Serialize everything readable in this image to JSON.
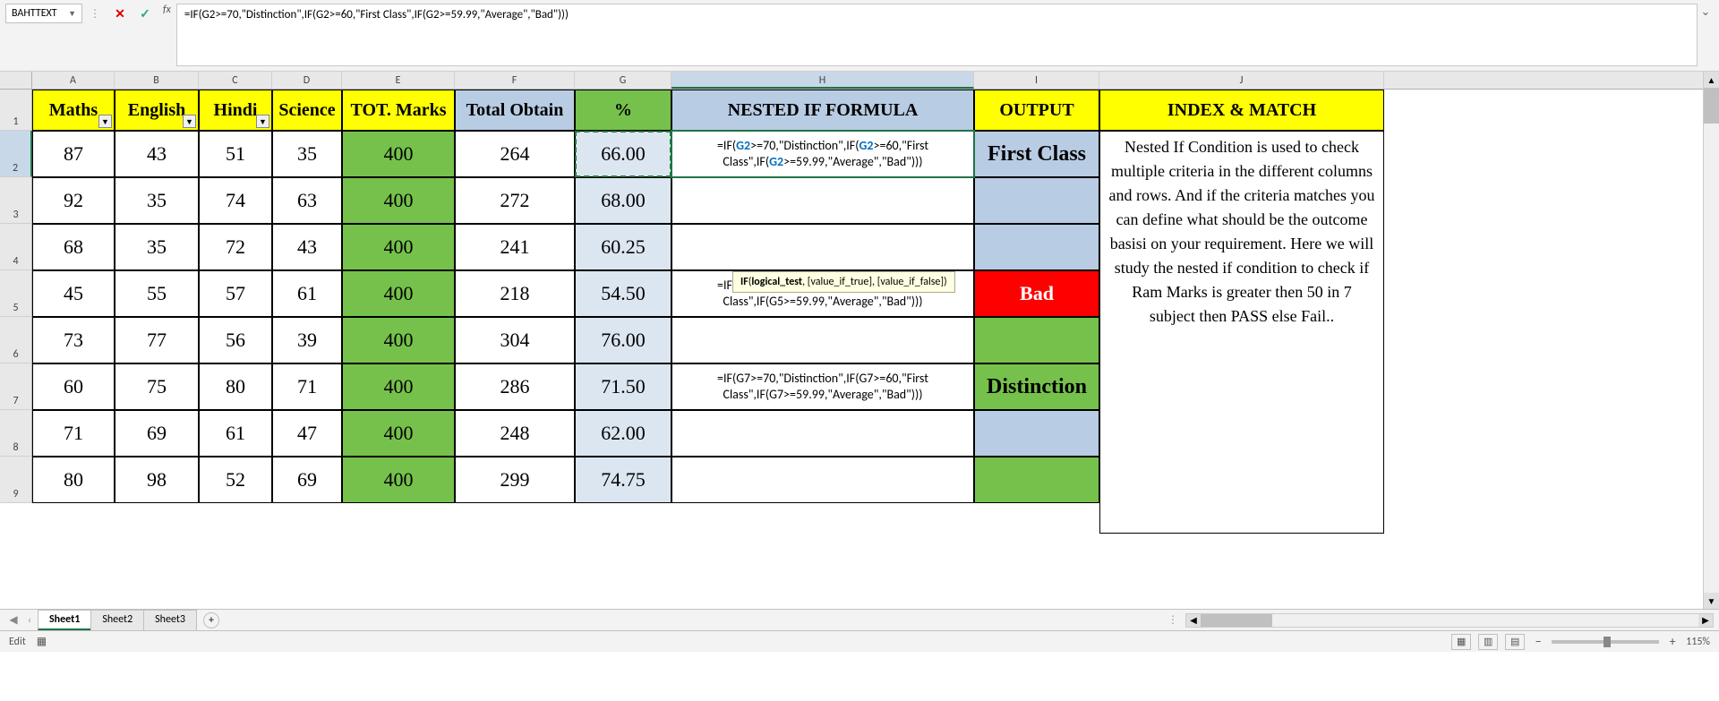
{
  "nameBox": "BAHTTEXT",
  "formulaBar": "=IF(G2>=70,\"Distinction\",IF(G2>=60,\"First Class\",IF(G2>=59.99,\"Average\",\"Bad\")))",
  "columns": [
    "A",
    "B",
    "C",
    "D",
    "E",
    "F",
    "G",
    "H",
    "I",
    "J"
  ],
  "headers": {
    "A": "Maths",
    "B": "English",
    "C": "Hindi",
    "D": "Science",
    "E": "TOT. Marks",
    "F": "Total Obtain",
    "G": "%",
    "H": "NESTED IF FORMULA",
    "I": "OUTPUT",
    "J": "INDEX & MATCH"
  },
  "rows": [
    {
      "n": 2,
      "A": "87",
      "B": "43",
      "C": "51",
      "D": "35",
      "E": "400",
      "F": "264",
      "G": "66.00",
      "H": "=IF(G2>=70,\"Distinction\",IF(G2>=60,\"First Class\",IF(G2>=59.99,\"Average\",\"Bad\")))",
      "I": "First Class",
      "Istyle": "first"
    },
    {
      "n": 3,
      "A": "92",
      "B": "35",
      "C": "74",
      "D": "63",
      "E": "400",
      "F": "272",
      "G": "68.00",
      "H": "",
      "I": "",
      "Istyle": "blue"
    },
    {
      "n": 4,
      "A": "68",
      "B": "35",
      "C": "72",
      "D": "43",
      "E": "400",
      "F": "241",
      "G": "60.25",
      "H": "",
      "I": "",
      "Istyle": "blue"
    },
    {
      "n": 5,
      "A": "45",
      "B": "55",
      "C": "57",
      "D": "61",
      "E": "400",
      "F": "218",
      "G": "54.50",
      "H": "=IF(G5>=70,\"Distinction\",IF(G5>=60,\"First Class\",IF(G5>=59.99,\"Average\",\"Bad\")))",
      "I": "Bad",
      "Istyle": "bad"
    },
    {
      "n": 6,
      "A": "73",
      "B": "77",
      "C": "56",
      "D": "39",
      "E": "400",
      "F": "304",
      "G": "76.00",
      "H": "",
      "I": "",
      "Istyle": "green"
    },
    {
      "n": 7,
      "A": "60",
      "B": "75",
      "C": "80",
      "D": "71",
      "E": "400",
      "F": "286",
      "G": "71.50",
      "H": "=IF(G7>=70,\"Distinction\",IF(G7>=60,\"First Class\",IF(G7>=59.99,\"Average\",\"Bad\")))",
      "I": "Distinction",
      "Istyle": "dist"
    },
    {
      "n": 8,
      "A": "71",
      "B": "69",
      "C": "61",
      "D": "47",
      "E": "400",
      "F": "248",
      "G": "62.00",
      "H": "",
      "I": "",
      "Istyle": "blue"
    },
    {
      "n": 9,
      "A": "80",
      "B": "98",
      "C": "52",
      "D": "69",
      "E": "400",
      "F": "299",
      "G": "74.75",
      "H": "",
      "I": "",
      "Istyle": "green"
    }
  ],
  "tooltip": {
    "fn": "IF",
    "sig": "(logical_test, [value_if_true], [value_if_false])"
  },
  "sideNote": "Nested If Condition is used to check multiple criteria in the different columns and rows. And if the criteria matches you can define what should be the outcome basisi on your requirement. Here we will study the nested if condition to check if Ram Marks is greater then 50 in 7 subject then PASS else Fail..",
  "sheets": [
    "Sheet1",
    "Sheet2",
    "Sheet3"
  ],
  "activeSheet": 0,
  "status": {
    "mode": "Edit",
    "zoom": "115%"
  },
  "editingCell": "H2",
  "refHighlight": "G2"
}
